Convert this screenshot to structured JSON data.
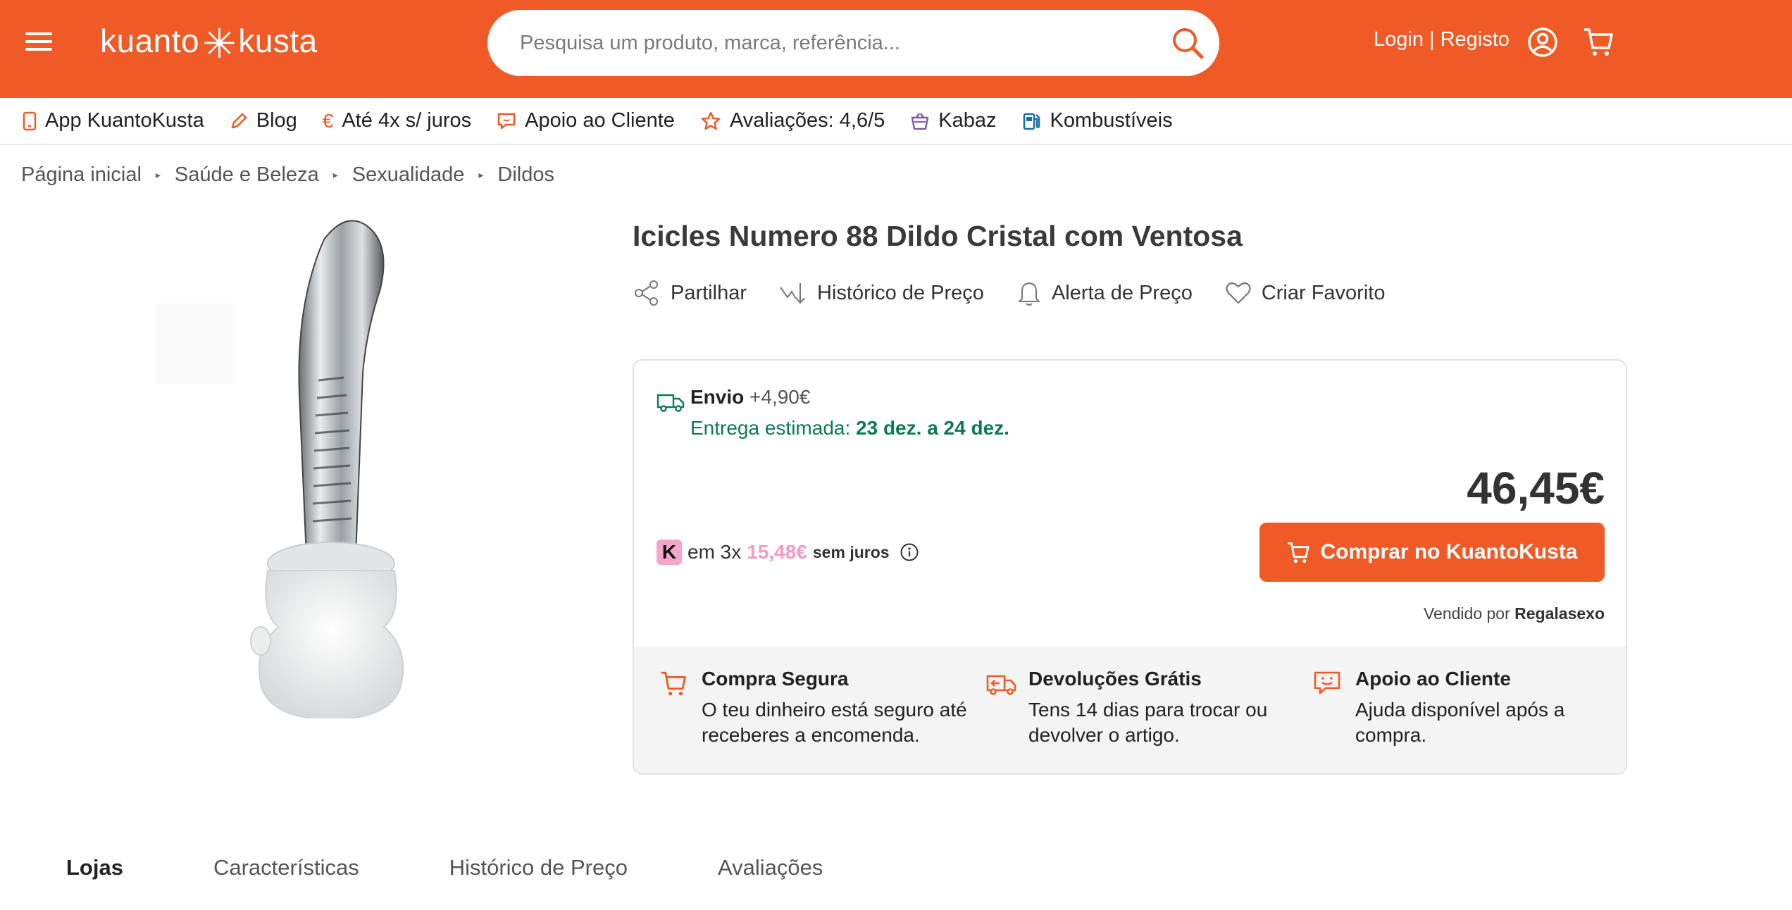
{
  "header": {
    "logo_left": "kuanto",
    "logo_right": "kusta",
    "search_placeholder": "Pesquisa um produto, marca, referência...",
    "login_label": "Login | Registo",
    "brand_color": "#f05a26"
  },
  "quick_nav": [
    {
      "label": "App KuantoKusta",
      "icon": "phone-icon"
    },
    {
      "label": "Blog",
      "icon": "pencil-icon"
    },
    {
      "label": "Até 4x s/ juros",
      "icon": "euro-icon"
    },
    {
      "label": "Apoio ao Cliente",
      "icon": "chat-icon"
    },
    {
      "label": "Avaliações: 4,6/5",
      "icon": "star-icon"
    },
    {
      "label": "Kabaz",
      "icon": "basket-icon"
    },
    {
      "label": "Kombustíveis",
      "icon": "fuel-icon"
    }
  ],
  "breadcrumb": [
    "Página inicial",
    "Saúde e Beleza",
    "Sexualidade",
    "Dildos"
  ],
  "product": {
    "title": "Icicles Numero 88 Dildo Cristal com Ventosa",
    "actions": [
      "Partilhar",
      "Histórico de Preço",
      "Alerta de Preço",
      "Criar Favorito"
    ]
  },
  "offer": {
    "shipping_label": "Envio",
    "shipping_price": "+4,90€",
    "delivery_prefix": "Entrega estimada:",
    "delivery_dates": "23 dez. a 24 dez.",
    "price": "46,45€",
    "klarna_letter": "K",
    "installments_prefix": "em 3x",
    "installment_amount": "15,48€",
    "installments_suffix": "sem juros",
    "buy_label": "Comprar no KuantoKusta",
    "seller_prefix": "Vendido por",
    "seller_name": "Regalasexo",
    "delivery_color": "#0c7a56"
  },
  "guarantees": [
    {
      "title": "Compra Segura",
      "desc": "O teu dinheiro está seguro até receberes a encomenda.",
      "icon": "cart-icon"
    },
    {
      "title": "Devoluções Grátis",
      "desc": "Tens 14 dias para trocar ou devolver o artigo.",
      "icon": "return-truck-icon"
    },
    {
      "title": "Apoio ao Cliente",
      "desc": "Ajuda disponível após a compra.",
      "icon": "chat-smile-icon"
    }
  ],
  "tabs": [
    "Lojas",
    "Características",
    "Histórico de Preço",
    "Avaliações"
  ],
  "active_tab": "Lojas"
}
